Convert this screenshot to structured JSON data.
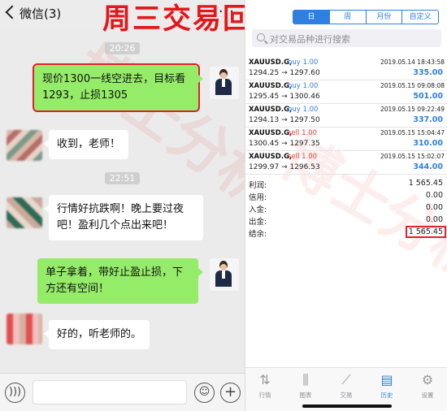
{
  "overlay": {
    "title": "周三交易回顾",
    "watermark": "博士分析师"
  },
  "chat": {
    "back_label": "微信(3)",
    "times": [
      "20:26",
      "22:51"
    ],
    "messages": [
      {
        "side": "out",
        "text": "现价1300一线空进去，目标看1293，止损1305",
        "highlight": true
      },
      {
        "side": "in",
        "text": "收到，老师！"
      },
      {
        "side": "in",
        "text": "行情好抗跌啊！晚上要过夜吧！盈利几个点出来吧！"
      },
      {
        "side": "out",
        "text": "单子拿着，带好止盈止损，下方还有空间！"
      },
      {
        "side": "in",
        "text": "好的，听老师的。"
      }
    ],
    "footer": {
      "voice_icon": "voice-icon",
      "emoji_icon": "emoji-icon",
      "plus_icon": "plus-icon"
    }
  },
  "app": {
    "segments": [
      "日",
      "周",
      "月份",
      "自定义"
    ],
    "active_segment": 0,
    "search_placeholder": "对交易品种进行搜索",
    "trades": [
      {
        "symbol": "XAUUSD.G,",
        "direction": "buy 1.00",
        "type": "buy",
        "date": "2019.05.14 18:43:58",
        "prices": "1294.25 → 1297.60",
        "profit": "335.00"
      },
      {
        "symbol": "XAUUSD.G,",
        "direction": "buy 1.00",
        "type": "buy",
        "date": "2019.05.15 09:08:08",
        "prices": "1295.45 → 1300.46",
        "profit": "501.00"
      },
      {
        "symbol": "XAUUSD.G,",
        "direction": "buy 1.00",
        "type": "buy",
        "date": "2019.05.15 09:22:49",
        "prices": "1294.13 → 1297.50",
        "profit": "337.00"
      },
      {
        "symbol": "XAUUSD.G,",
        "direction": "sell 1.00",
        "type": "sell",
        "date": "2019.05.15 15:04:47",
        "prices": "1300.45 → 1297.35",
        "profit": "310.00"
      },
      {
        "symbol": "XAUUSD.G,",
        "direction": "sell 1.00",
        "type": "sell",
        "date": "2019.05.15 15:02:07",
        "prices": "1299.97 → 1296.53",
        "profit": "344.00"
      }
    ],
    "summary": [
      {
        "label": "利润:",
        "value": "1 565.45"
      },
      {
        "label": "信用:",
        "value": "0.00"
      },
      {
        "label": "入金:",
        "value": "0.00"
      },
      {
        "label": "出金:",
        "value": "0.00"
      },
      {
        "label": "结余:",
        "value": "1 565.45",
        "highlight": true
      }
    ],
    "tabs": [
      {
        "label": "行情",
        "icon": "quotes-icon"
      },
      {
        "label": "图表",
        "icon": "chart-icon"
      },
      {
        "label": "交易",
        "icon": "trade-icon"
      },
      {
        "label": "历史",
        "icon": "history-icon",
        "active": true
      },
      {
        "label": "设置",
        "icon": "settings-icon"
      }
    ],
    "colors": {
      "accent": "#2f7fe0",
      "sell": "#e23a2e",
      "highlight_box": "#e0202a",
      "overlay_title": "#e3171c"
    }
  }
}
